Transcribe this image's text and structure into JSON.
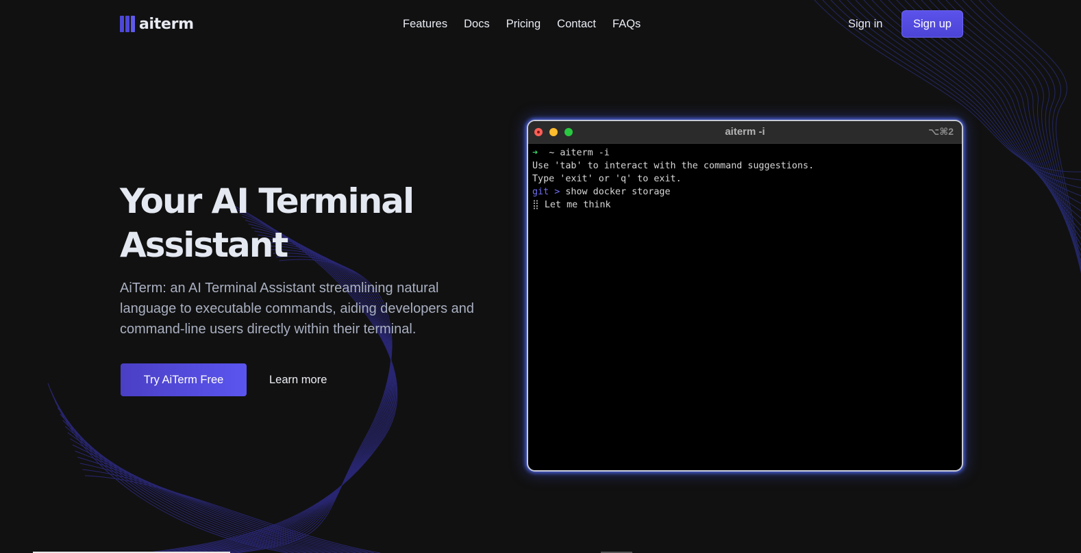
{
  "header": {
    "brand": "aiterm",
    "nav": [
      "Features",
      "Docs",
      "Pricing",
      "Contact",
      "FAQs"
    ],
    "signin_label": "Sign in",
    "signup_label": "Sign up"
  },
  "hero": {
    "title_line1": "Your AI Terminal",
    "title_line2": "Assistant",
    "description": "AiTerm: an AI Terminal Assistant streamlining natural language to executable commands, aiding developers and command-line users directly within their terminal.",
    "cta_primary": "Try AiTerm Free",
    "cta_secondary": "Learn more"
  },
  "terminal": {
    "title": "aiterm -i",
    "shortcut": "⌥⌘2",
    "prompt_arrow": "➜",
    "prompt_path": "~",
    "command": "aiterm -i",
    "line2": "Use 'tab' to interact with the command suggestions.",
    "line3": "Type 'exit' or 'q' to exit.",
    "git_prompt": "git >",
    "git_input": "show docker storage",
    "spinner": "⣿",
    "thinking": "Let me think"
  },
  "colors": {
    "background": "#111111",
    "accent": "#5b52ea",
    "glow": "#5670ff",
    "prompt_green": "#3fd068",
    "git_purple": "#6f6ef2"
  },
  "icons": {
    "logo": "logo-bars-icon",
    "close": "window-close-icon",
    "minimize": "window-minimize-icon",
    "maximize": "window-maximize-icon"
  }
}
